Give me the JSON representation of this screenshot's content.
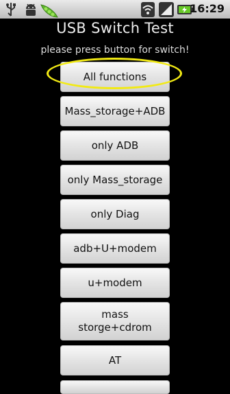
{
  "status_bar": {
    "time": "16:29",
    "icons": [
      "usb-icon",
      "android-debug-icon",
      "peapod-app-icon",
      "wifi-icon",
      "signal-icon",
      "battery-charging-icon"
    ]
  },
  "app": {
    "title": "USB Switch Test",
    "subtitle": "please press button for switch!"
  },
  "buttons": [
    {
      "label": "All functions"
    },
    {
      "label": "Mass_storage+ADB"
    },
    {
      "label": "only ADB"
    },
    {
      "label": "only Mass_storage"
    },
    {
      "label": "only Diag"
    },
    {
      "label": "adb+U+modem"
    },
    {
      "label": "u+modem"
    },
    {
      "label": "mass\nstorge+cdrom"
    },
    {
      "label": "AT"
    }
  ],
  "annotation": {
    "highlight_color": "#f2ea14"
  }
}
